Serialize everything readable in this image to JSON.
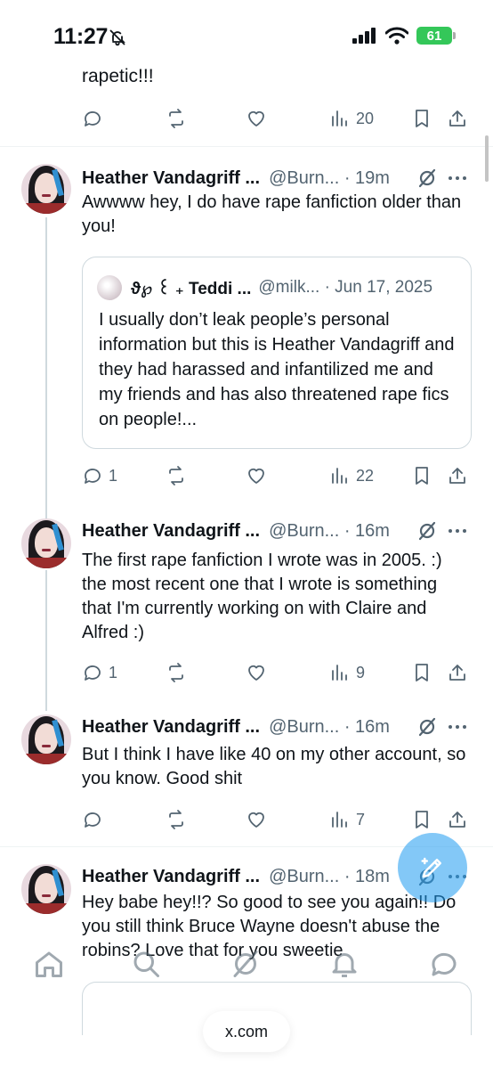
{
  "status_bar": {
    "time": "11:27",
    "battery": "61"
  },
  "partial_tweet": {
    "text": "rapetic!!!",
    "actions": {
      "replies": "",
      "reposts": "",
      "likes": "",
      "views": "20"
    }
  },
  "tweets": [
    {
      "name": "Heather Vandagriff ...",
      "handle": "@Burn... · 19m",
      "text": "Awwww hey, I do have rape fanfiction older than you!",
      "quote": {
        "name": "ϑ℘ ꒰ ₊ Teddi ...",
        "handle": "@milk... · Jun 17, 2025",
        "text": "I usually don’t leak people’s personal information but this is Heather Vandagriff and they had harassed and infantilized me and my friends and has also threatened rape fics on people!..."
      },
      "actions": {
        "replies": "1",
        "reposts": "",
        "likes": "",
        "views": "22"
      }
    },
    {
      "name": "Heather Vandagriff ...",
      "handle": "@Burn... · 16m",
      "text": "The first rape fanfiction I wrote was in 2005. :) the most recent one that I wrote is something that I'm currently working on with Claire and Alfred :)",
      "actions": {
        "replies": "1",
        "reposts": "",
        "likes": "",
        "views": "9"
      }
    },
    {
      "name": "Heather Vandagriff ...",
      "handle": "@Burn... · 16m",
      "text": "But I think I have like 40 on my other account, so you know. Good shit",
      "actions": {
        "replies": "",
        "reposts": "",
        "likes": "",
        "views": "7"
      }
    },
    {
      "name": "Heather Vandagriff ...",
      "handle": "@Burn... · 18m",
      "text": "Hey babe hey!!? So good to see you again!! Do you still think Bruce Wayne doesn't abuse the robins? Love that for you sweetie"
    }
  ],
  "browser": {
    "url": "x.com"
  },
  "icons": {
    "reply": "reply-icon",
    "repost": "repost-icon",
    "like": "heart-icon",
    "views": "views-icon",
    "bookmark": "bookmark-icon",
    "share": "share-icon",
    "grok": "grok-icon",
    "more": "more-icon",
    "compose": "compose-icon",
    "nav": [
      "home-icon",
      "search-icon",
      "grok-icon",
      "notifications-icon",
      "messages-icon"
    ]
  },
  "colors": {
    "accent": "#1d9bf0",
    "secondary_text": "#536471",
    "battery": "#34c759"
  }
}
